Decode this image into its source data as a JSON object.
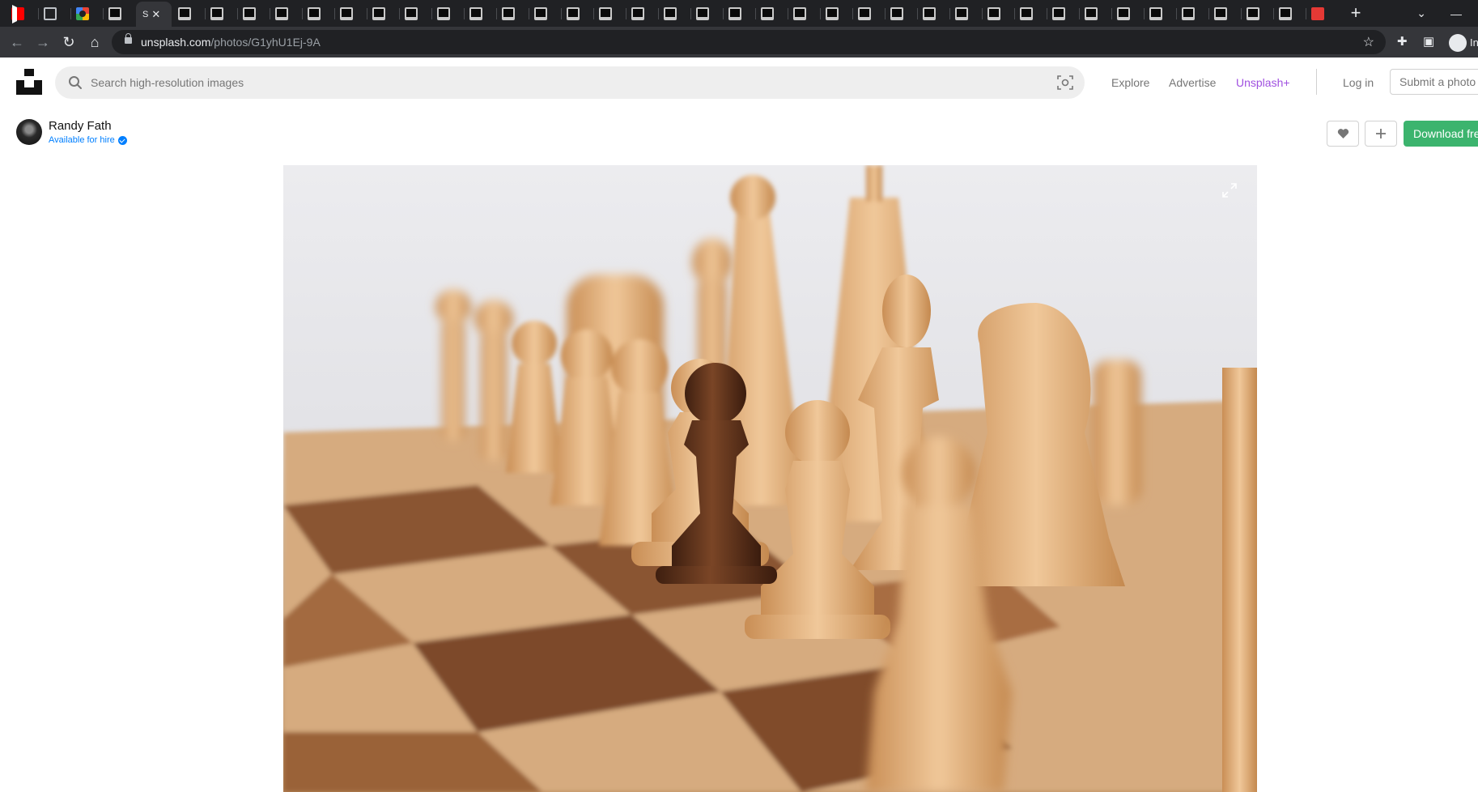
{
  "browser": {
    "active_tab_title": "S",
    "url_host": "unsplash.com",
    "url_path": "/photos/G1yhU1Ej-9A",
    "profile_label": "In"
  },
  "header": {
    "search_placeholder": "Search high-resolution images",
    "nav": {
      "explore": "Explore",
      "advertise": "Advertise",
      "unsplash_plus": "Unsplash+",
      "login": "Log in",
      "submit": "Submit a photo"
    }
  },
  "photo": {
    "author": "Randy Fath",
    "availability": "Available for hire",
    "download_label": "Download free"
  },
  "colors": {
    "download_green": "#3cb46e",
    "unsplash_plus_purple": "#a050e0",
    "hire_blue": "#007fff"
  },
  "icons": [
    "search-icon",
    "visual-search-icon",
    "heart-icon",
    "plus-icon",
    "expand-icon",
    "lock-icon",
    "star-icon",
    "extensions-icon",
    "sidebar-icon",
    "incognito-icon"
  ]
}
